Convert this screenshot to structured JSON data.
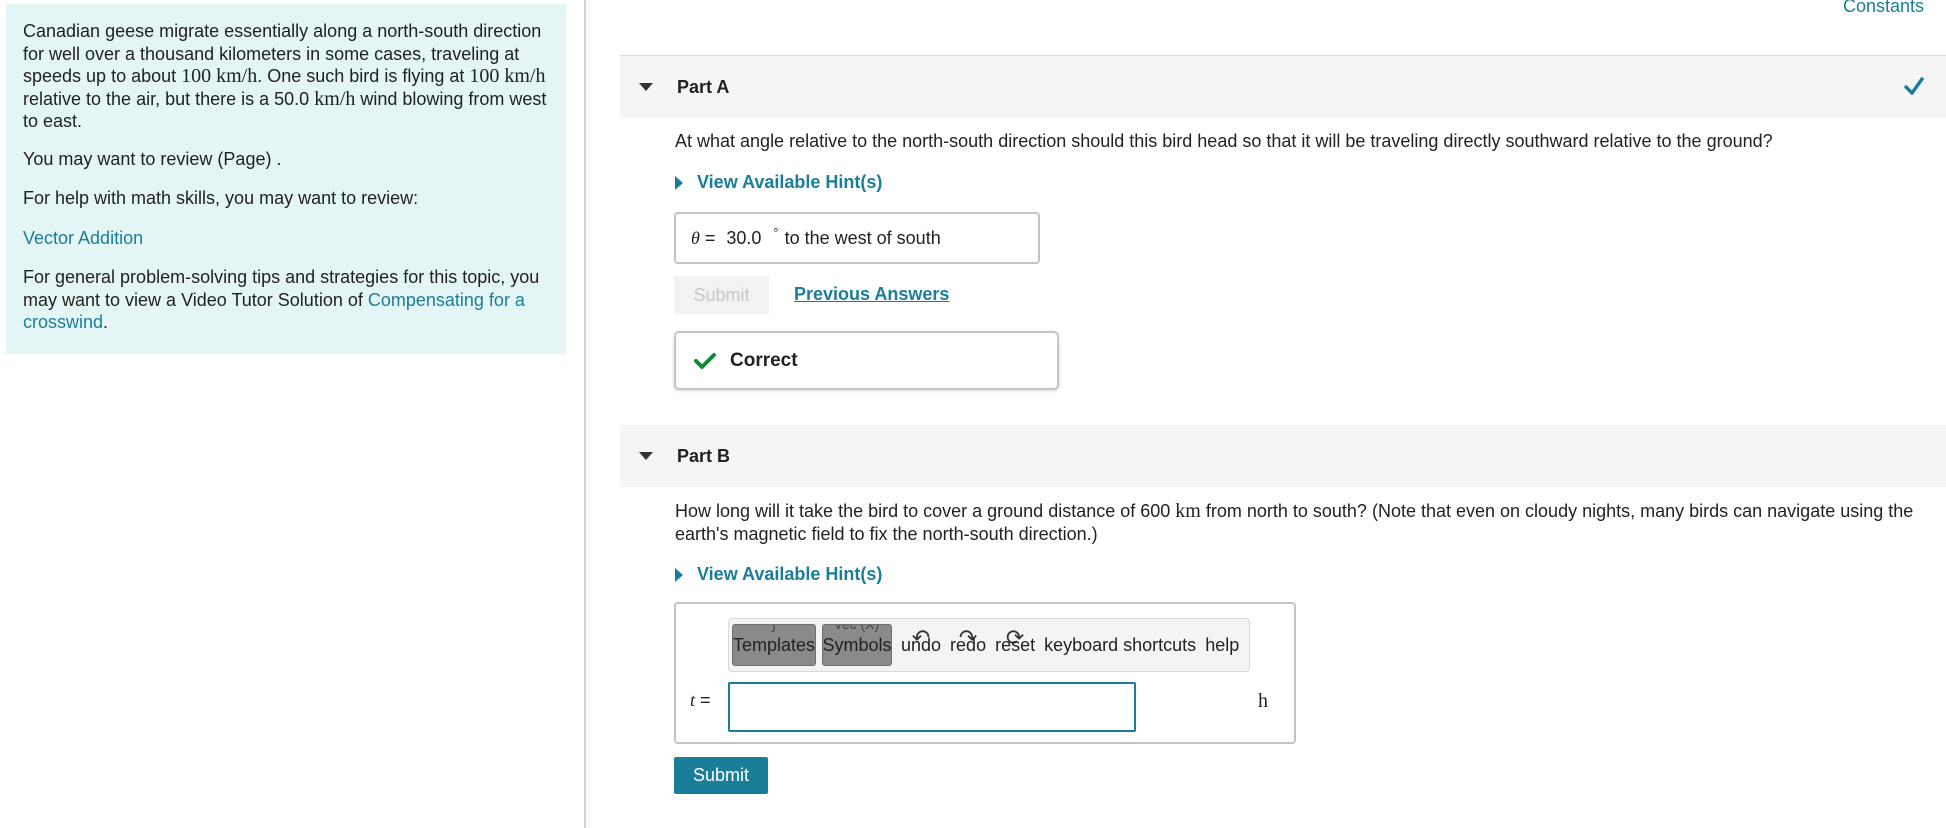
{
  "intro": {
    "p1_pre": "Canadian geese migrate essentially along a north-south direction for well over a thousand kilometers in some cases, traveling at speeds up to about ",
    "speed_max": "100",
    "unit_kmh": "km/h",
    "p1_mid1": ". One such bird is flying at ",
    "bird_speed": "100",
    "p1_mid2": " relative to the air, but there is a ",
    "wind_speed": "50.0",
    "p1_post": " wind blowing from west to east.",
    "review_page": "You may want to review (Page) .",
    "math_help": "For help with math skills, you may want to review:",
    "vector_link": "Vector Addition",
    "tips_pre": "For general problem-solving tips and strategies for this topic, you may want to view a Video Tutor Solution of ",
    "tips_link": "Compensating for a crosswind",
    "tips_post": "."
  },
  "constants_link": "Constants",
  "partA": {
    "title": "Part A",
    "question": "At what angle relative to the north-south direction should this bird head so that it will be traveling directly southward relative to the ground?",
    "hint_label": "View Available Hint(s)",
    "var": "θ",
    "eq": " = ",
    "value": "30.0",
    "degree": "°",
    "direction": "to the west of south",
    "submit_label": "Submit",
    "previous_answers": "Previous Answers",
    "feedback": "Correct"
  },
  "partB": {
    "title": "Part B",
    "question_pre": "How long will it take the bird to cover a ground distance of 600 ",
    "question_unit": "km",
    "question_post": " from north to south? (Note that even on cloudy nights, many birds can navigate using the earth's magnetic field to fix the north-south direction.)",
    "hint_label": "View Available Hint(s)",
    "toolbar": {
      "templates": "Templates",
      "symbols": "Symbols",
      "undo": "undo",
      "redo": "redo",
      "reset": "reset",
      "shortcuts": "keyboard shortcuts",
      "help": "help"
    },
    "var": "t",
    "eq": " = ",
    "input_value": "",
    "unit": "h",
    "submit_label": "Submit"
  },
  "colors": {
    "accent": "#1b7e98",
    "intro_bg": "#e3f5f5",
    "correct_green": "#138a36"
  }
}
